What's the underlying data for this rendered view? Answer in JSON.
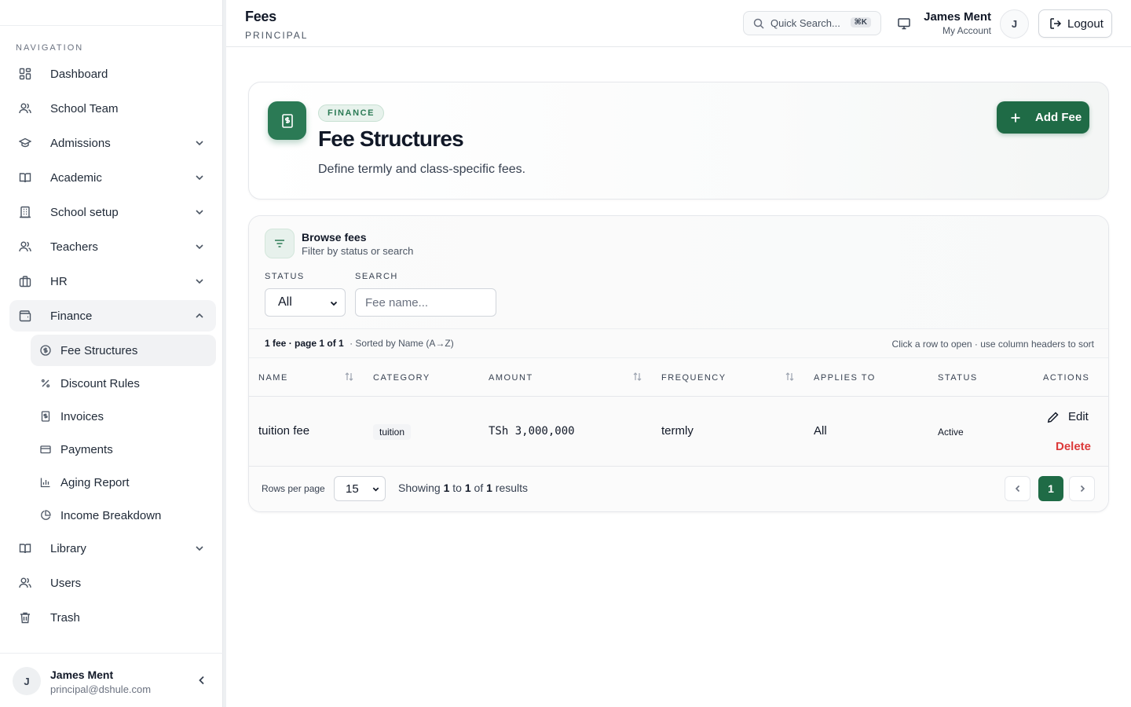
{
  "sidebar": {
    "nav_heading": "NAVIGATION",
    "items": [
      {
        "label": "Dashboard",
        "icon": "dashboard-icon"
      },
      {
        "label": "School Team",
        "icon": "users-icon"
      },
      {
        "label": "Admissions",
        "icon": "graduation-cap-icon"
      },
      {
        "label": "Academic",
        "icon": "book-icon"
      },
      {
        "label": "School setup",
        "icon": "building-icon"
      },
      {
        "label": "Teachers",
        "icon": "users-icon"
      },
      {
        "label": "HR",
        "icon": "briefcase-icon"
      },
      {
        "label": "Finance",
        "icon": "wallet-icon"
      },
      {
        "label": "Library",
        "icon": "book-icon"
      },
      {
        "label": "Users",
        "icon": "users-icon"
      },
      {
        "label": "Trash",
        "icon": "trash-icon"
      }
    ],
    "finance_sub": [
      {
        "label": "Fee Structures",
        "icon": "dollar-circle-icon"
      },
      {
        "label": "Discount Rules",
        "icon": "percent-icon"
      },
      {
        "label": "Invoices",
        "icon": "receipt-icon"
      },
      {
        "label": "Payments",
        "icon": "credit-card-icon"
      },
      {
        "label": "Aging Report",
        "icon": "bar-chart-icon"
      },
      {
        "label": "Income Breakdown",
        "icon": "pie-chart-icon"
      }
    ],
    "footer": {
      "avatar_initial": "J",
      "name": "James Ment",
      "email": "principal@dshule.com"
    }
  },
  "header": {
    "title": "Fees",
    "subtitle": "PRINCIPAL",
    "search_placeholder": "Quick Search...",
    "search_shortcut": "⌘K",
    "user_name": "James Ment",
    "user_sub": "My Account",
    "avatar_initial": "J",
    "logout_label": "Logout"
  },
  "hero": {
    "badge": "FINANCE",
    "title": "Fee Structures",
    "description": "Define termly and class-specific fees.",
    "add_button": "Add Fee"
  },
  "browse": {
    "title": "Browse fees",
    "subtitle": "Filter by status or search",
    "status_label": "STATUS",
    "status_value": "All",
    "search_label": "SEARCH",
    "search_placeholder": "Fee name...",
    "summary_count": "1 fee",
    "summary_sep": " · ",
    "summary_page": "page 1 of 1",
    "summary_sorted": "· Sorted by Name (A→Z)",
    "hint": "Click a row to open · use column headers to sort"
  },
  "table": {
    "columns": [
      "NAME",
      "CATEGORY",
      "AMOUNT",
      "FREQUENCY",
      "APPLIES TO",
      "STATUS",
      "ACTIONS"
    ],
    "rows": [
      {
        "name": "tuition fee",
        "category": "tuition",
        "amount": "TSh 3,000,000",
        "frequency": "termly",
        "applies_to": "All",
        "status": "Active",
        "edit_label": "Edit",
        "delete_label": "Delete"
      }
    ]
  },
  "pagination": {
    "rows_per_page_label": "Rows per page",
    "rows_per_page": "15",
    "showing_prefix": "Showing ",
    "from": "1",
    "to_word": " to ",
    "to": "1",
    "of_word": " of ",
    "total": "1",
    "results_word": " results",
    "current_page": "1"
  },
  "colors": {
    "accent": "#1f6b46",
    "danger": "#dc3a3a"
  }
}
